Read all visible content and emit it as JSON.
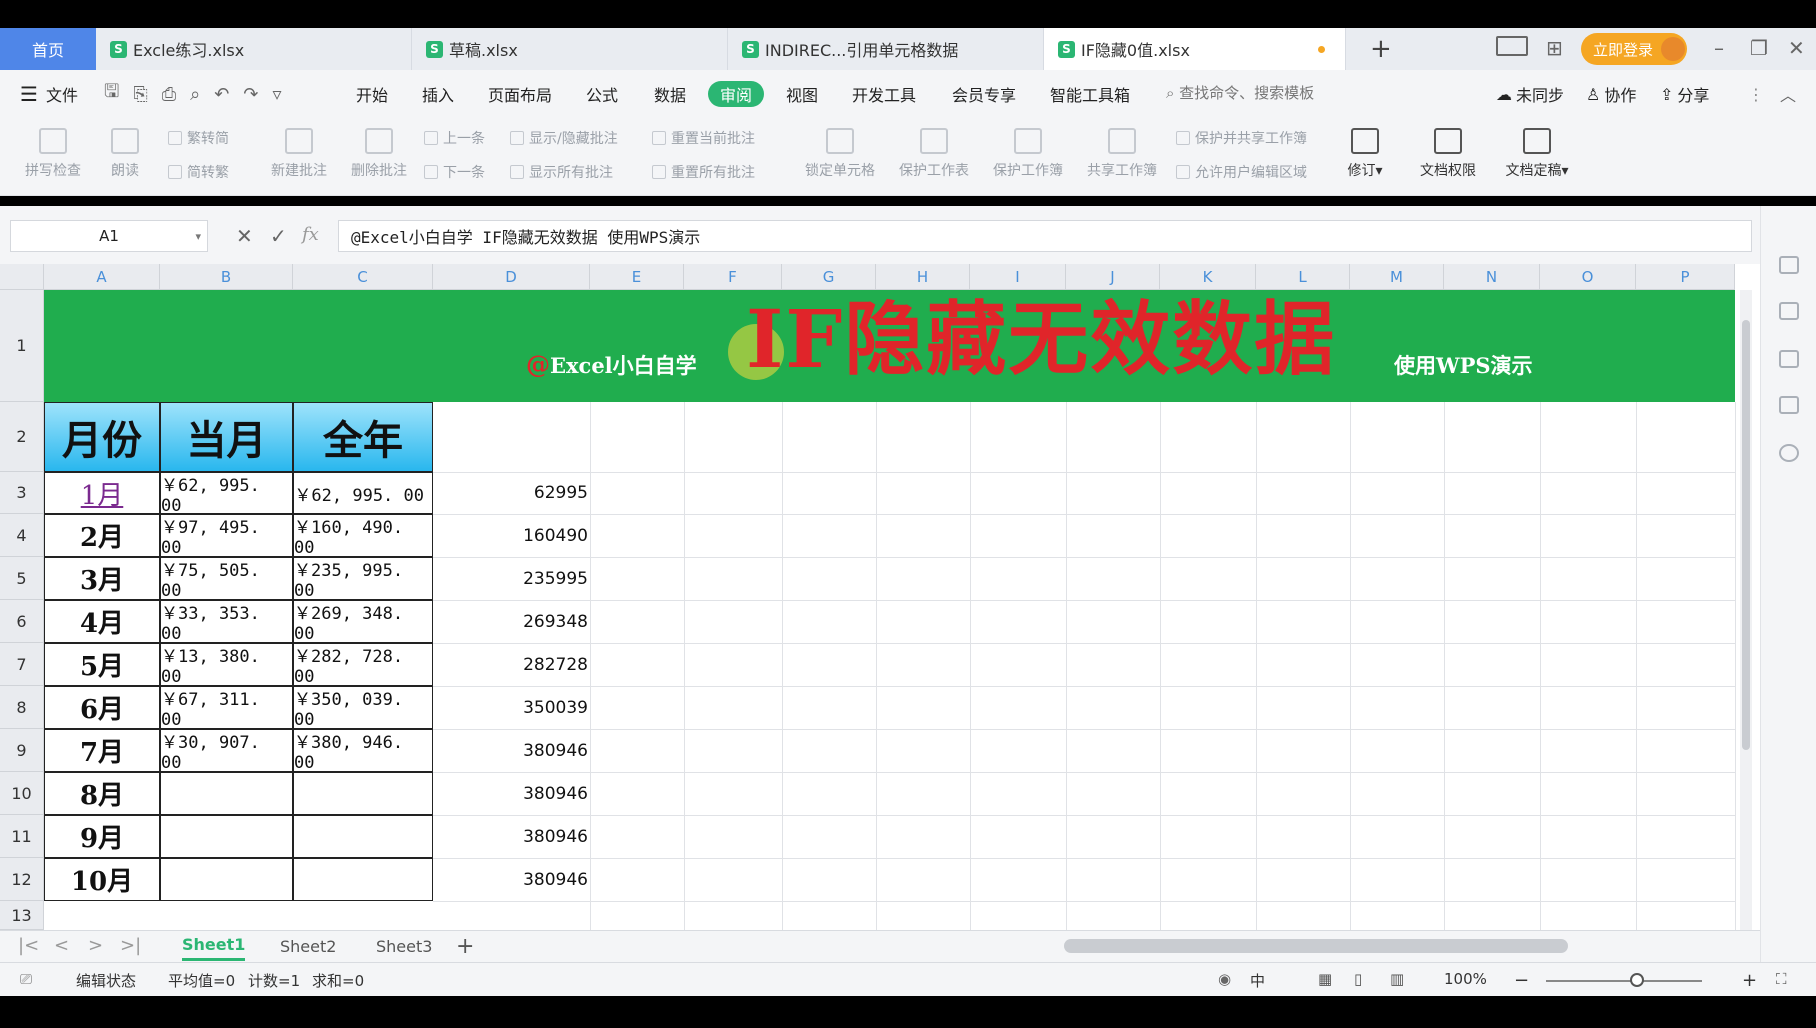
{
  "tabbar": {
    "home": "首页",
    "files": [
      {
        "name": "Excle练习.xlsx",
        "badge": "S"
      },
      {
        "name": "草稿.xlsx",
        "badge": "S"
      },
      {
        "name": "INDIREC...引用单元格数据",
        "badge": "S"
      },
      {
        "name": "IF隐藏0值.xlsx",
        "badge": "S"
      }
    ],
    "new_tab": "+",
    "login": "立即登录"
  },
  "menu": {
    "file": "文件",
    "items": [
      "开始",
      "插入",
      "页面布局",
      "公式",
      "数据",
      "审阅",
      "视图",
      "开发工具",
      "会员专享",
      "智能工具箱"
    ],
    "active": "审阅",
    "search": "查找命令、搜索模板",
    "sync": "未同步",
    "collab": "协作",
    "share": "分享"
  },
  "ribbon": {
    "spell": "拼写检查",
    "read": "朗读",
    "trad": "繁转简",
    "simp": "简转繁",
    "new_comment": "新建批注",
    "del_comment": "删除批注",
    "prev": "上一条",
    "next": "下一条",
    "show_hide": "显示/隐藏批注",
    "show_all": "显示所有批注",
    "reset_cur": "重置当前批注",
    "reset_all": "重置所有批注",
    "lock_cell": "锁定单元格",
    "protect_sheet": "保护工作表",
    "protect_book": "保护工作簿",
    "share_book": "共享工作簿",
    "protect_share": "保护并共享工作簿",
    "allow_edit": "允许用户编辑区域",
    "revise": "修订",
    "doc_perm": "文档权限",
    "doc_final": "文档定稿"
  },
  "formula": {
    "name_box": "A1",
    "fx": "fx",
    "content": "@Excel小白自学 IF隐藏无效数据 使用WPS演示"
  },
  "grid": {
    "columns": [
      "A",
      "B",
      "C",
      "D",
      "E",
      "F",
      "G",
      "H",
      "I",
      "J",
      "K",
      "L",
      "M",
      "N",
      "O",
      "P"
    ],
    "rows": [
      "1",
      "2",
      "3",
      "4",
      "5",
      "6",
      "7",
      "8",
      "9",
      "10",
      "11",
      "12",
      "13"
    ],
    "banner": {
      "author": "Excel小白自学",
      "at": "@",
      "title": "IF隐藏无效数据",
      "note": "使用WPS演示"
    },
    "headers": [
      "月份",
      "当月",
      "全年"
    ],
    "data": [
      {
        "month": "1月",
        "cur": "￥62, 995. 00",
        "total": "￥62, 995. 00",
        "d": "62995"
      },
      {
        "month": "2月",
        "cur": "￥97, 495. 00",
        "total": "￥160, 490. 00",
        "d": "160490"
      },
      {
        "month": "3月",
        "cur": "￥75, 505. 00",
        "total": "￥235, 995. 00",
        "d": "235995"
      },
      {
        "month": "4月",
        "cur": "￥33, 353. 00",
        "total": "￥269, 348. 00",
        "d": "269348"
      },
      {
        "month": "5月",
        "cur": "￥13, 380. 00",
        "total": "￥282, 728. 00",
        "d": "282728"
      },
      {
        "month": "6月",
        "cur": "￥67, 311. 00",
        "total": "￥350, 039. 00",
        "d": "350039"
      },
      {
        "month": "7月",
        "cur": "￥30, 907. 00",
        "total": "￥380, 946. 00",
        "d": "380946"
      },
      {
        "month": "8月",
        "cur": "",
        "total": "",
        "d": "380946"
      },
      {
        "month": "9月",
        "cur": "",
        "total": "",
        "d": "380946"
      },
      {
        "month": "10月",
        "cur": "",
        "total": "",
        "d": "380946"
      }
    ]
  },
  "sheets": {
    "tabs": [
      "Sheet1",
      "Sheet2",
      "Sheet3"
    ],
    "active": "Sheet1",
    "add": "+"
  },
  "status": {
    "mode": "编辑状态",
    "avg": "平均值=0",
    "count": "计数=1",
    "sum": "求和=0",
    "ime": "中",
    "zoom": "100%"
  },
  "colors": {
    "accent": "#2bb673",
    "banner": "#20ad4e",
    "title_red": "#e0252a",
    "header_blue": "#29b7ee"
  }
}
